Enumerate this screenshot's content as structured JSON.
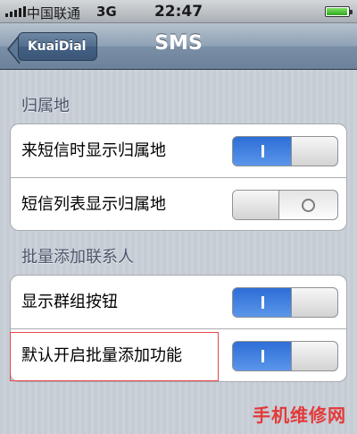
{
  "status_bar": {
    "carrier": "中国联通",
    "network": "3G",
    "time": "22:47",
    "battery_level": 0.95
  },
  "nav": {
    "back_label": "KuaiDial",
    "title": "SMS"
  },
  "sections": [
    {
      "header": "归属地",
      "rows": [
        {
          "label": "来短信时显示归属地",
          "toggle": "on"
        },
        {
          "label": "短信列表显示归属地",
          "toggle": "off"
        }
      ]
    },
    {
      "header": "批量添加联系人",
      "rows": [
        {
          "label": "显示群组按钮",
          "toggle": "on"
        },
        {
          "label": "默认开启批量添加功能",
          "toggle": "on"
        }
      ]
    }
  ],
  "watermark": "手机维修网",
  "colors": {
    "toggle_on": "#2d6ed6",
    "highlight_border": "#e3474b",
    "watermark": "#e33a3a"
  }
}
